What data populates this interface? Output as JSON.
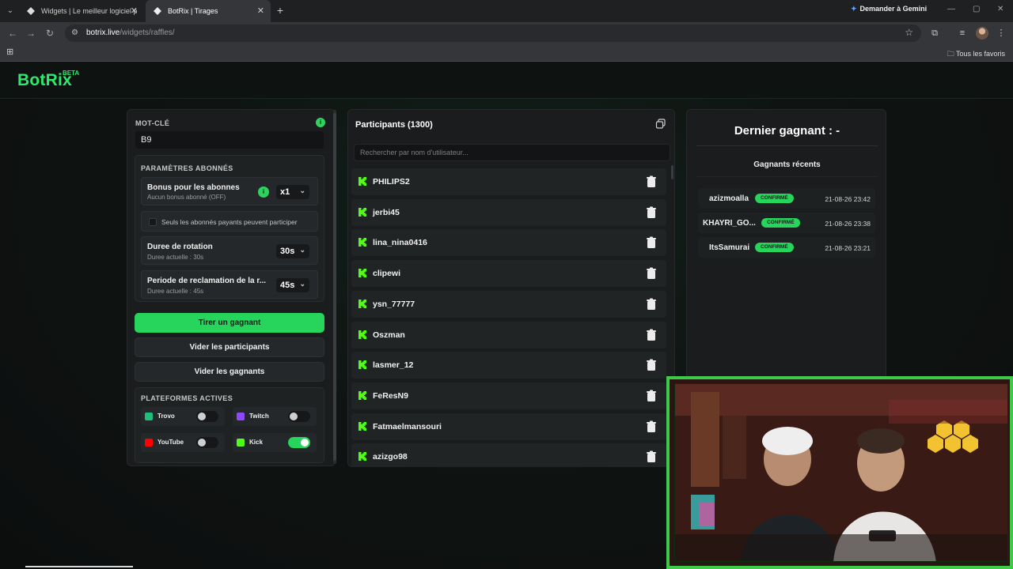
{
  "browser": {
    "tabs": [
      {
        "title": "Widgets | Le meilleur logiciel p",
        "active": false
      },
      {
        "title": "BotRix | Tirages",
        "active": true
      }
    ],
    "gemini_label": "Demander à Gemini",
    "url_domain": "botrix.live",
    "url_path": "/widgets/raffles/",
    "bookmarks_folder": "Tous les favoris"
  },
  "app": {
    "logo": "BotRix",
    "beta": "BETA"
  },
  "settings": {
    "keyword_label": "MOT-CLÉ",
    "keyword_value": "B9",
    "subs_section": "PARAMÈTRES ABONNÉS",
    "bonus_title": "Bonus pour les abonnes",
    "bonus_sub": "Aucun bonus abonné (OFF)",
    "bonus_value": "x1",
    "paid_only_label": "Seuls les abonnés payants peuvent participer",
    "rotation_title": "Duree de rotation",
    "rotation_sub": "Duree actuelle : 30s",
    "rotation_value": "30s",
    "claim_title": "Periode de reclamation de la r...",
    "claim_sub": "Duree actuelle : 45s",
    "claim_value": "45s",
    "draw_button": "Tirer un gagnant",
    "clear_participants": "Vider les participants",
    "clear_winners": "Vider les gagnants",
    "platforms_section": "PLATEFORMES ACTIVES",
    "platforms": [
      {
        "name": "Trovo",
        "enabled": false,
        "color": "#1fbf7a"
      },
      {
        "name": "Twitch",
        "enabled": false,
        "color": "#9146ff"
      },
      {
        "name": "YouTube",
        "enabled": false,
        "color": "#ff0000"
      },
      {
        "name": "Kick",
        "enabled": true,
        "color": "#53fc18"
      }
    ]
  },
  "participants": {
    "title": "Participants (1300)",
    "search_placeholder": "Rechercher par nom d'utilisateur...",
    "items": [
      "PHILIPS2",
      "jerbi45",
      "lina_nina0416",
      "clipewi",
      "ysn_77777",
      "Oszman",
      "lasmer_12",
      "FeResN9",
      "Fatmaelmansouri",
      "azizgo98"
    ]
  },
  "winners": {
    "last_winner": "Dernier gagnant : -",
    "recent_title": "Gagnants récents",
    "items": [
      {
        "name": "azizmoalla",
        "status": "CONFIRMÉ",
        "date": "21-08-26 23:42"
      },
      {
        "name": "KHAYRI_GO...",
        "status": "CONFIRMÉ",
        "date": "21-08-26 23:38"
      },
      {
        "name": "ItsSamurai",
        "status": "CONFIRMÉ",
        "date": "21-08-26 23:21"
      }
    ]
  },
  "colors": {
    "accent": "#27d45c",
    "kick": "#53fc18"
  }
}
